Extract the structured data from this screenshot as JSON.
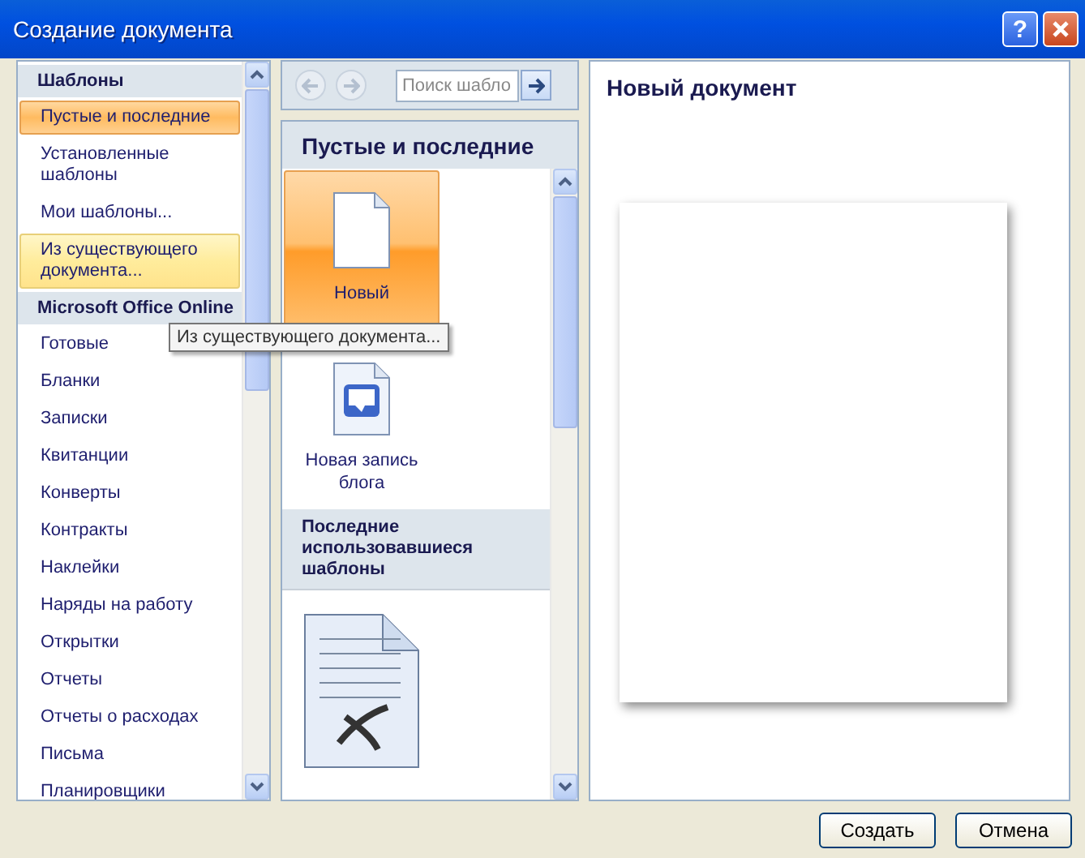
{
  "window": {
    "title": "Создание документа",
    "help": "?"
  },
  "sidebar": {
    "items": [
      {
        "kind": "header",
        "label": "Шаблоны"
      },
      {
        "kind": "item",
        "label": "Пустые и последние",
        "selected": true,
        "highlighted": false
      },
      {
        "kind": "item",
        "label": "Установленные шаблоны",
        "selected": false,
        "highlighted": false
      },
      {
        "kind": "item",
        "label": "Мои шаблоны...",
        "selected": false,
        "highlighted": false
      },
      {
        "kind": "item",
        "label": "Из существующего документа...",
        "selected": false,
        "highlighted": true
      },
      {
        "kind": "header",
        "label": "Microsoft Office Online"
      },
      {
        "kind": "item",
        "label": "Готовые",
        "selected": false,
        "highlighted": false
      },
      {
        "kind": "item",
        "label": "Бланки",
        "selected": false,
        "highlighted": false
      },
      {
        "kind": "item",
        "label": "Записки",
        "selected": false,
        "highlighted": false
      },
      {
        "kind": "item",
        "label": "Квитанции",
        "selected": false,
        "highlighted": false
      },
      {
        "kind": "item",
        "label": "Конверты",
        "selected": false,
        "highlighted": false
      },
      {
        "kind": "item",
        "label": "Контракты",
        "selected": false,
        "highlighted": false
      },
      {
        "kind": "item",
        "label": "Наклейки",
        "selected": false,
        "highlighted": false
      },
      {
        "kind": "item",
        "label": "Наряды на работу",
        "selected": false,
        "highlighted": false
      },
      {
        "kind": "item",
        "label": "Открытки",
        "selected": false,
        "highlighted": false
      },
      {
        "kind": "item",
        "label": "Отчеты",
        "selected": false,
        "highlighted": false
      },
      {
        "kind": "item",
        "label": "Отчеты о расходах",
        "selected": false,
        "highlighted": false
      },
      {
        "kind": "item",
        "label": "Письма",
        "selected": false,
        "highlighted": false
      },
      {
        "kind": "item",
        "label": "Планировщики",
        "selected": false,
        "highlighted": false
      }
    ]
  },
  "tooltip": "Из существующего документа...",
  "toolbar": {
    "search_placeholder": "Поиск шабло"
  },
  "gallery": {
    "title": "Пустые и последние",
    "items": [
      {
        "kind": "blank",
        "label": "Новый",
        "selected": true
      },
      {
        "kind": "blog",
        "label": "Новая запись блога",
        "selected": false
      },
      {
        "kind": "section",
        "label": "Последние использовавшиеся шаблоны"
      },
      {
        "kind": "recent",
        "selected": false
      }
    ]
  },
  "preview": {
    "title": "Новый документ"
  },
  "buttons": [
    "Создать",
    "Отмена"
  ]
}
